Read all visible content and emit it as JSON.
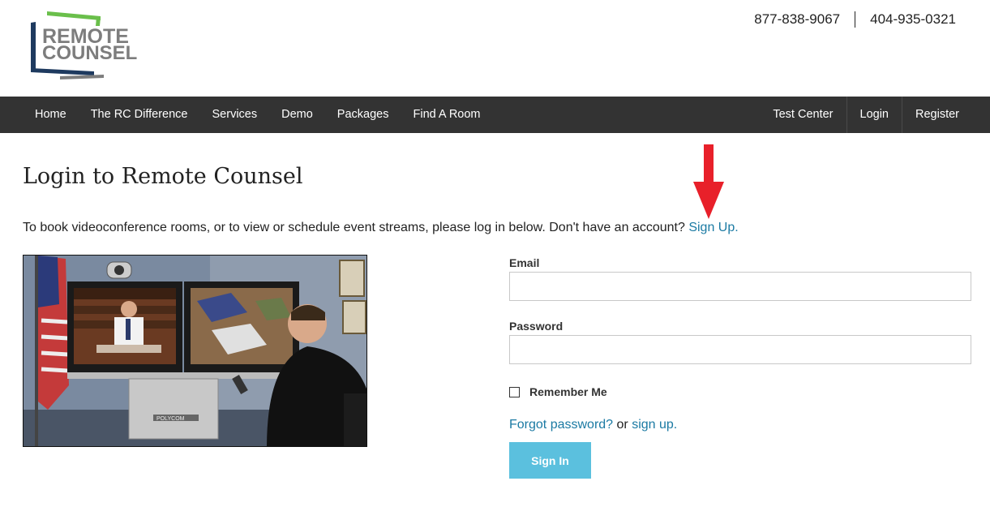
{
  "brand": {
    "logo_line1": "REMOTE",
    "logo_line2": "COUNSEL",
    "logo_colors": {
      "green": "#6abf4b",
      "navy": "#1e3a5f",
      "gray": "#7d7d7d"
    }
  },
  "header": {
    "phone_primary": "877-838-9067",
    "phone_secondary": "404-935-0321"
  },
  "nav": {
    "left_items": [
      "Home",
      "The RC Difference",
      "Services",
      "Demo",
      "Packages",
      "Find A Room"
    ],
    "right_items": [
      "Test Center",
      "Login",
      "Register"
    ],
    "background": "#333333"
  },
  "main": {
    "title": "Login to Remote Counsel",
    "intro_text": "To book videoconference rooms, or to view or schedule event streams, please log in below. Don't have an account? ",
    "intro_link": "Sign Up",
    "intro_period": ".",
    "annotation": {
      "type": "arrow",
      "icon": "arrow-down-icon",
      "color": "#e8202a"
    },
    "photo": {
      "icon": "videoconference-photo",
      "caption_text": "POLYCOM"
    }
  },
  "form": {
    "email_label": "Email",
    "email_value": "",
    "password_label": "Password",
    "password_value": "",
    "remember_label": "Remember Me",
    "remember_checked": false,
    "forgot_link": "Forgot password?",
    "or_text": " or ",
    "signup_link": "sign up",
    "signup_period": ".",
    "submit_label": "Sign In",
    "submit_color": "#5bc0de",
    "link_color": "#1b7aa3"
  }
}
